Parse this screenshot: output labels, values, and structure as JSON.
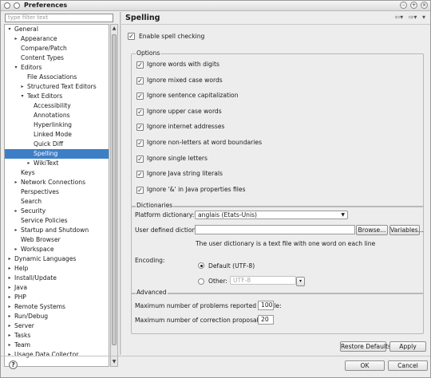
{
  "window": {
    "title": "Preferences"
  },
  "filter": {
    "placeholder": "type filter text"
  },
  "tree": [
    {
      "label": "General",
      "depth": 0,
      "arrow": "▾"
    },
    {
      "label": "Appearance",
      "depth": 1,
      "arrow": "▸"
    },
    {
      "label": "Compare/Patch",
      "depth": 1,
      "arrow": ""
    },
    {
      "label": "Content Types",
      "depth": 1,
      "arrow": ""
    },
    {
      "label": "Editors",
      "depth": 1,
      "arrow": "▾"
    },
    {
      "label": "File Associations",
      "depth": 2,
      "arrow": ""
    },
    {
      "label": "Structured Text Editors",
      "depth": 2,
      "arrow": "▸"
    },
    {
      "label": "Text Editors",
      "depth": 2,
      "arrow": "▾"
    },
    {
      "label": "Accessibility",
      "depth": 3,
      "arrow": ""
    },
    {
      "label": "Annotations",
      "depth": 3,
      "arrow": ""
    },
    {
      "label": "Hyperlinking",
      "depth": 3,
      "arrow": ""
    },
    {
      "label": "Linked Mode",
      "depth": 3,
      "arrow": ""
    },
    {
      "label": "Quick Diff",
      "depth": 3,
      "arrow": ""
    },
    {
      "label": "Spelling",
      "depth": 3,
      "arrow": "",
      "selected": true
    },
    {
      "label": "WikiText",
      "depth": 3,
      "arrow": "▸"
    },
    {
      "label": "Keys",
      "depth": 1,
      "arrow": ""
    },
    {
      "label": "Network Connections",
      "depth": 1,
      "arrow": "▸"
    },
    {
      "label": "Perspectives",
      "depth": 1,
      "arrow": ""
    },
    {
      "label": "Search",
      "depth": 1,
      "arrow": ""
    },
    {
      "label": "Security",
      "depth": 1,
      "arrow": "▸"
    },
    {
      "label": "Service Policies",
      "depth": 1,
      "arrow": ""
    },
    {
      "label": "Startup and Shutdown",
      "depth": 1,
      "arrow": "▸"
    },
    {
      "label": "Web Browser",
      "depth": 1,
      "arrow": ""
    },
    {
      "label": "Workspace",
      "depth": 1,
      "arrow": "▸"
    },
    {
      "label": "Dynamic Languages",
      "depth": 0,
      "arrow": "▸"
    },
    {
      "label": "Help",
      "depth": 0,
      "arrow": "▸"
    },
    {
      "label": "Install/Update",
      "depth": 0,
      "arrow": "▸"
    },
    {
      "label": "Java",
      "depth": 0,
      "arrow": "▸"
    },
    {
      "label": "PHP",
      "depth": 0,
      "arrow": "▸"
    },
    {
      "label": "Remote Systems",
      "depth": 0,
      "arrow": "▸"
    },
    {
      "label": "Run/Debug",
      "depth": 0,
      "arrow": "▸"
    },
    {
      "label": "Server",
      "depth": 0,
      "arrow": "▸"
    },
    {
      "label": "Tasks",
      "depth": 0,
      "arrow": "▸"
    },
    {
      "label": "Team",
      "depth": 0,
      "arrow": "▸"
    },
    {
      "label": "Usage Data Collector",
      "depth": 0,
      "arrow": "▸"
    }
  ],
  "page": {
    "title": "Spelling",
    "enable_spell": "Enable spell checking",
    "options_title": "Options",
    "options": [
      "Ignore words with digits",
      "Ignore mixed case words",
      "Ignore sentence capitalization",
      "Ignore upper case words",
      "Ignore internet addresses",
      "Ignore non-letters at word boundaries",
      "Ignore single letters",
      "Ignore Java string literals",
      "Ignore '&' in Java properties files"
    ],
    "dict_title": "Dictionaries",
    "platform_label": "Platform dictionary:",
    "platform_value": "anglais (Etats-Unis)",
    "user_dict_label": "User defined dictionary:",
    "user_dict_value": "",
    "browse": "Browse...",
    "variables": "Variables...",
    "user_dict_note": "The user dictionary is a text file with one word on each line",
    "encoding_label": "Encoding:",
    "default_enc": "Default (UTF-8)",
    "other_enc": "Other:",
    "other_value": "UTF-8",
    "advanced_title": "Advanced",
    "max_problems_label": "Maximum number of problems reported per file:",
    "max_problems": "100",
    "max_proposals_label": "Maximum number of correction proposals:",
    "max_proposals": "20",
    "restore": "Restore Defaults",
    "apply": "Apply"
  },
  "footer": {
    "ok": "OK",
    "cancel": "Cancel"
  }
}
